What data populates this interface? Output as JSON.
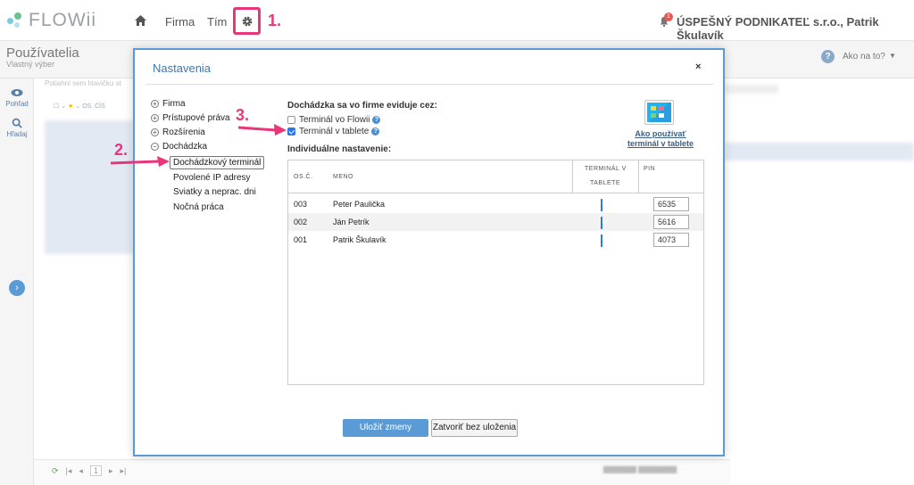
{
  "app": {
    "logo_text": "FLOWii",
    "company_user": "ÚSPEŠNÝ PODNIKATEĽ s.r.o., Patrik Škulavík",
    "notifications": "1"
  },
  "nav": {
    "firma": "Firma",
    "tim": "Tím",
    "settings_icon": "gear-icon",
    "home_icon": "home-icon"
  },
  "annotations": {
    "step1": "1.",
    "step2": "2.",
    "step3": "3.",
    "accent": "#e8367a"
  },
  "page": {
    "title": "Používatelia",
    "subtitle": "Vlastný výber",
    "help": "Ako na to?"
  },
  "rail": {
    "pohlad": "Pohľad",
    "hladaj": "Hľadaj"
  },
  "background": {
    "search_hint": "Potiahni sem hlavičku st",
    "col_hint": "OS. ČÍS",
    "pager_page": "1"
  },
  "modal": {
    "title": "Nastavenia",
    "close": "×",
    "tree": {
      "items": [
        "Firma",
        "Prístupové práva",
        "Rozšírenia",
        "Dochádzka"
      ],
      "children": [
        "Dochádzkový terminál",
        "Povolené IP adresy",
        "Sviatky a neprac. dni",
        "Nočná práca"
      ]
    },
    "section_title": "Dochádzka sa vo firme eviduje cez:",
    "options": [
      {
        "label": "Terminál vo Flowii",
        "checked": false
      },
      {
        "label": "Terminál v tablete",
        "checked": true
      }
    ],
    "tablet_link": "Ako používať terminál v tablete",
    "individual_title": "Individuálne nastavenie:",
    "table": {
      "headers": {
        "os": "OS.Č.",
        "meno": "MENO",
        "terminal_1": "TERMINÁL V",
        "terminal_2": "TABLETE",
        "pin": "PIN"
      },
      "rows": [
        {
          "os": "003",
          "meno": "Peter Paulička",
          "tablet": true,
          "pin": "6535"
        },
        {
          "os": "002",
          "meno": "Ján Petrík",
          "tablet": true,
          "pin": "5616"
        },
        {
          "os": "001",
          "meno": "Patrik Škulavík",
          "tablet": true,
          "pin": "4073"
        }
      ]
    },
    "save": "Uložiť zmeny",
    "cancel": "Zatvoriť bez uloženia"
  }
}
